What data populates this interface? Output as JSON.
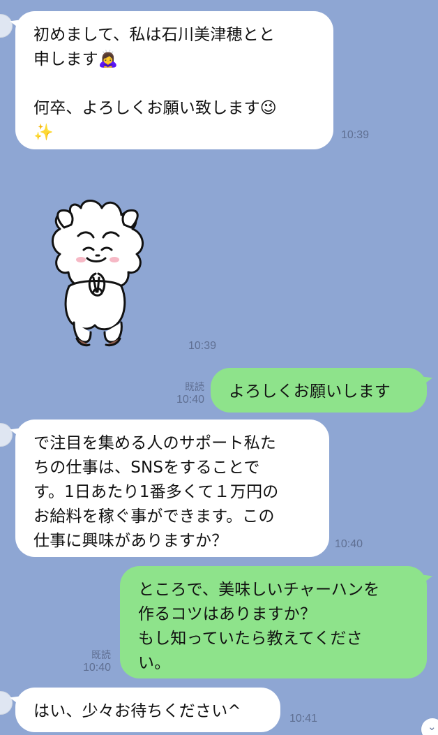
{
  "messages": [
    {
      "text": "初めまして、私は石川美津穂とと\n申します🙇‍♀️\n\n何卒、よろしくお願い致します😉\n✨",
      "time": "10:39"
    },
    {
      "time": "10:39"
    },
    {
      "text": "よろしくお願いします",
      "read": "既読",
      "time": "10:40"
    },
    {
      "text": "で注目を集める人のサポート私た\nちの仕事は、SNSをすることで\nす。1日あたり1番多くて１万円の\nお給料を稼ぐ事ができます。この\n仕事に興味がありますか？",
      "time": "10:40"
    },
    {
      "text": "ところで、美味しいチャーハンを\n作るコツはありますか？\nもし知っていたら教えてくださ\nい。",
      "read": "既読",
      "time": "10:40"
    },
    {
      "text": "はい、少々お待ちください^",
      "time": "10:41"
    }
  ],
  "icons": {
    "avatar": "avatar",
    "scroll": "chevron-down-icon"
  },
  "colors": {
    "background": "#8ea6d3",
    "incoming": "#ffffff",
    "outgoing": "#8ee38b",
    "meta": "#5f6f92"
  }
}
